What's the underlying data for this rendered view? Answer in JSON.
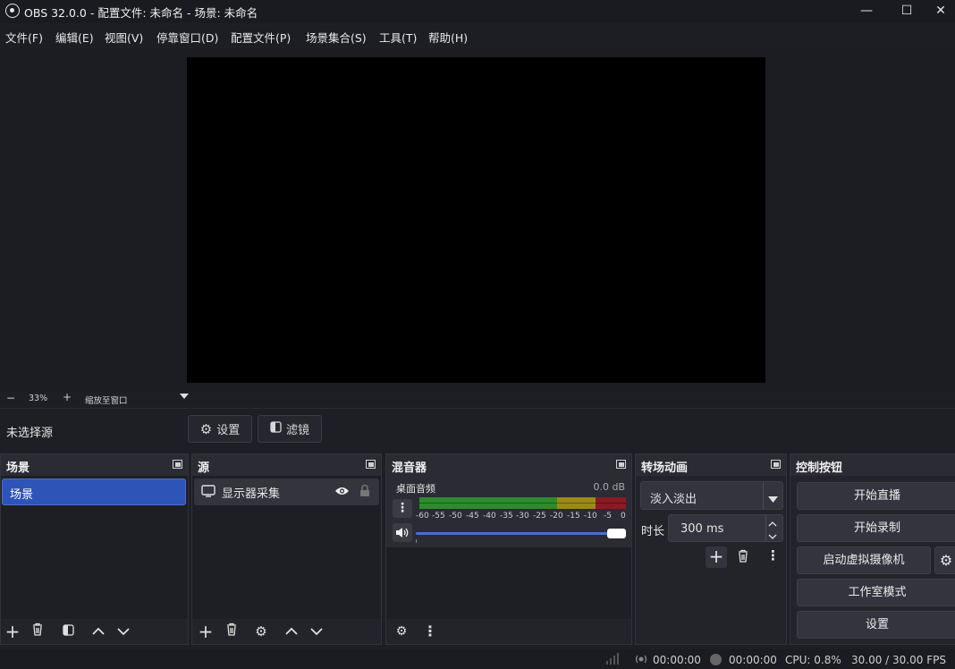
{
  "window": {
    "title": "OBS 32.0.0 - 配置文件: 未命名 - 场景: 未命名",
    "minimize": "—",
    "maximize": "☐",
    "close": "✕"
  },
  "menu": [
    "文件(F)",
    "编辑(E)",
    "视图(V)",
    "停靠窗口(D)",
    "配置文件(P)",
    "场景集合(S)",
    "工具(T)",
    "帮助(H)"
  ],
  "zoom": {
    "minus": "−",
    "value": "33%",
    "plus": "+",
    "mode": "缩放至窗口"
  },
  "source_bar": {
    "status": "未选择源",
    "settings": "设置",
    "filters": "滤镜"
  },
  "scenes": {
    "title": "场景",
    "items": [
      "场景"
    ]
  },
  "sources": {
    "title": "源",
    "items": [
      "显示器采集"
    ]
  },
  "mixer": {
    "title": "混音器",
    "track_name": "桌面音频",
    "level": "0.0 dB",
    "ticks": [
      "-60",
      "-55",
      "-50",
      "-45",
      "-40",
      "-35",
      "-30",
      "-25",
      "-20",
      "-15",
      "-10",
      "-5",
      "0"
    ],
    "volume_fraction": 1.0
  },
  "transitions": {
    "title": "转场动画",
    "selected": "淡入淡出",
    "duration_label": "时长",
    "duration": "300 ms"
  },
  "controls": {
    "title": "控制按钮",
    "buttons": [
      "开始直播",
      "开始录制",
      "启动虚拟摄像机",
      "工作室模式",
      "设置"
    ]
  },
  "status": {
    "stream_time": "00:00:00",
    "rec_time": "00:00:00",
    "cpu": "CPU: 0.8%",
    "fps": "30.00 / 30.00 FPS"
  },
  "colors": {
    "accent": "#2f54b8",
    "meter_green": "#2e8a2e",
    "meter_yellow": "#9a8a1a",
    "meter_red": "#8a1a24"
  }
}
